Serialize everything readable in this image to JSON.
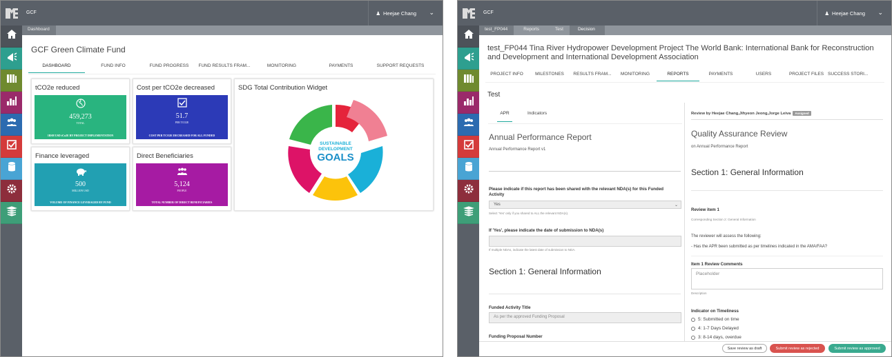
{
  "left": {
    "app_name": "GCF",
    "user_name": "Heejae Chang",
    "breadcrumb": [
      "Dashboard"
    ],
    "title": "GCF Green Climate Fund",
    "tabs": [
      "DASHBOARD",
      "FUND INFO",
      "FUND PROGRESS",
      "FUND RESULTS FRAM...",
      "MONITORING",
      "PAYMENTS",
      "SUPPORT REQUESTS"
    ],
    "active_tab": 0,
    "cards": [
      {
        "title": "tCO2e reduced",
        "value": "459,273",
        "unit": "TOTAL",
        "caption": "1BSH USD tCo2E BY PROJECT IMPLEMENTATION",
        "color": "#29b47f"
      },
      {
        "title": "Cost per tCO2e decreased",
        "value": "51.7",
        "unit": "PER TCO2E",
        "caption": "COST PER TCO2E DECREASED FOR ALL FUNDED",
        "color": "#2c3ab7"
      },
      {
        "title": "Finance leveraged",
        "value": "500",
        "unit": "MILLION USD",
        "caption": "VOLUME OF FINANCE LEVERAGED BY FUND",
        "color": "#22a0b2"
      },
      {
        "title": "Direct Beneficiaries",
        "value": "5,124",
        "unit": "PEOPLE",
        "caption": "TOTAL NUMBER OF DIRECT BENEFICIARIES",
        "color": "#a61ba3"
      }
    ],
    "widget_title": "SDG Total Contribution Widget",
    "sdg_logo": [
      "SUSTAINABLE",
      "DEVELOPMENT",
      "GOALS"
    ],
    "donut_colors": [
      "#e5243b",
      "#f08093",
      "#1ab0d8",
      "#fcc30b",
      "#dd1367",
      "#3ab54a"
    ]
  },
  "right": {
    "app_name": "GCF",
    "user_name": "Heejae Chang",
    "breadcrumb": [
      "test_FP044",
      "Reports",
      "Test",
      "Decision"
    ],
    "title": "test_FP044 Tina River Hydropower Development Project The World Bank: International Bank for Reconstruction and Development and International Development Association",
    "tabs": [
      "PROJECT INFO",
      "MILESTONES",
      "RESULTS FRAM...",
      "MONITORING",
      "REPORTS",
      "PAYMENTS",
      "USERS",
      "PROJECT FILES",
      "SUCCESS STORI..."
    ],
    "active_tab": 4,
    "report_name": "Test",
    "sub_tabs": [
      "APR",
      "Indicators"
    ],
    "apr_heading": "Annual Performance Report",
    "apr_sub": "Annual Performance Report v1",
    "q1_label": "Please indicate if this report has been shared with the relevant NDA(s) for this Funded Activity",
    "q1_value": "Yes",
    "q1_help": "Select 'Yes' only if you shared to ALL the relevant NDA(s).",
    "q2_label": "If 'Yes', please indicate the date of submission to NDA(s)",
    "q2_help": "If multiple NDAs, indicate the latest date of submission to NDA.",
    "section1": "Section 1: General Information",
    "fa_title_label": "Funded Activity Title",
    "fa_title_value": "As per the approved Funding Proposal",
    "fp_number_label": "Funding Proposal Number",
    "review_by": "Review by Heejae Chang,Jihyeon Jeong,Jorge Leiva",
    "review_badge": "Assigned",
    "qa_heading": "Quality Assurance Review",
    "qa_sub": "on Annual Performance Report",
    "qa_section": "Section 1: General Information",
    "review_item": "Review item 1",
    "review_item_sub": "Corresponding Section 2: General Information",
    "assess_intro": "The reviewer will assess the following:",
    "assess_point": "- Has the APR been submitted as per timelines indicated in the AMA/FAA?",
    "comments_label": "Item 1 Review Comments",
    "comments_placeholder": "Placeholder",
    "comments_help": "Description",
    "timeliness_label": "Indicator on Timeliness",
    "timeliness_options": [
      "5: Submitted on time",
      "4: 1-7 Days Delayed",
      "3: 8-14 days, overdue"
    ],
    "buttons": [
      "Save review as draft",
      "Submit review as rejected",
      "Submit review as approved"
    ]
  },
  "sidebar_colors": [
    "#5a6068",
    "#2e9f8f",
    "#6f8a2f",
    "#9a2a6a",
    "#2c6bb0",
    "#d43b3b",
    "#49a4d4",
    "#8d2e3c",
    "#3e9e78"
  ],
  "sidebar_icons": [
    "home-icon",
    "megaphone-icon",
    "binders-icon",
    "bar-chart-icon",
    "group-icon",
    "checkbox-icon",
    "database-icon",
    "gear-icon",
    "books-icon"
  ]
}
